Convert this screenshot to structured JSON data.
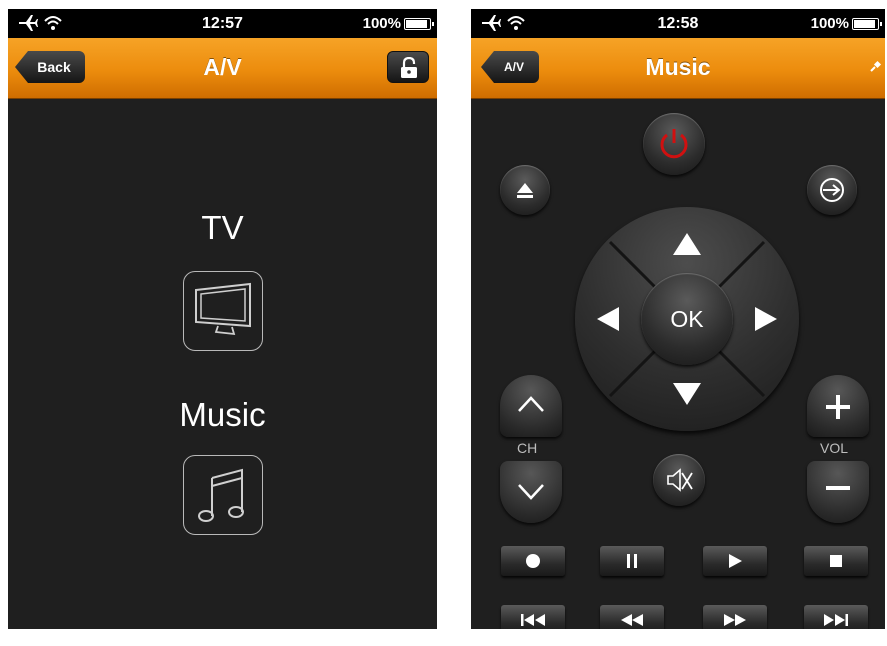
{
  "left_screen": {
    "status": {
      "time": "12:57",
      "battery": "100%",
      "battery_level": 1.0
    },
    "navbar": {
      "title": "A/V",
      "back_label": "Back"
    },
    "items": [
      {
        "label": "TV",
        "icon": "tv-icon"
      },
      {
        "label": "Music",
        "icon": "music-note-icon"
      }
    ]
  },
  "right_screen": {
    "status": {
      "time": "12:58",
      "battery": "100%",
      "battery_level": 1.0
    },
    "navbar": {
      "title": "Music",
      "back_label": "A/V"
    },
    "remote": {
      "dpad_center": "OK",
      "channel_label": "CH",
      "volume_label": "VOL",
      "power_color": "#d01010",
      "icons": [
        "power-icon",
        "eject-icon",
        "input-source-icon",
        "mute-icon",
        "channel-up-icon",
        "channel-down-icon",
        "volume-up-icon",
        "volume-down-icon"
      ],
      "transport_row1": [
        "record-icon",
        "pause-icon",
        "play-icon",
        "stop-icon"
      ],
      "transport_row2": [
        "skip-back-icon",
        "rewind-icon",
        "fast-forward-icon",
        "skip-forward-icon"
      ]
    }
  },
  "colors": {
    "accent": "#ec8c0d",
    "background": "#1f1f1f"
  }
}
